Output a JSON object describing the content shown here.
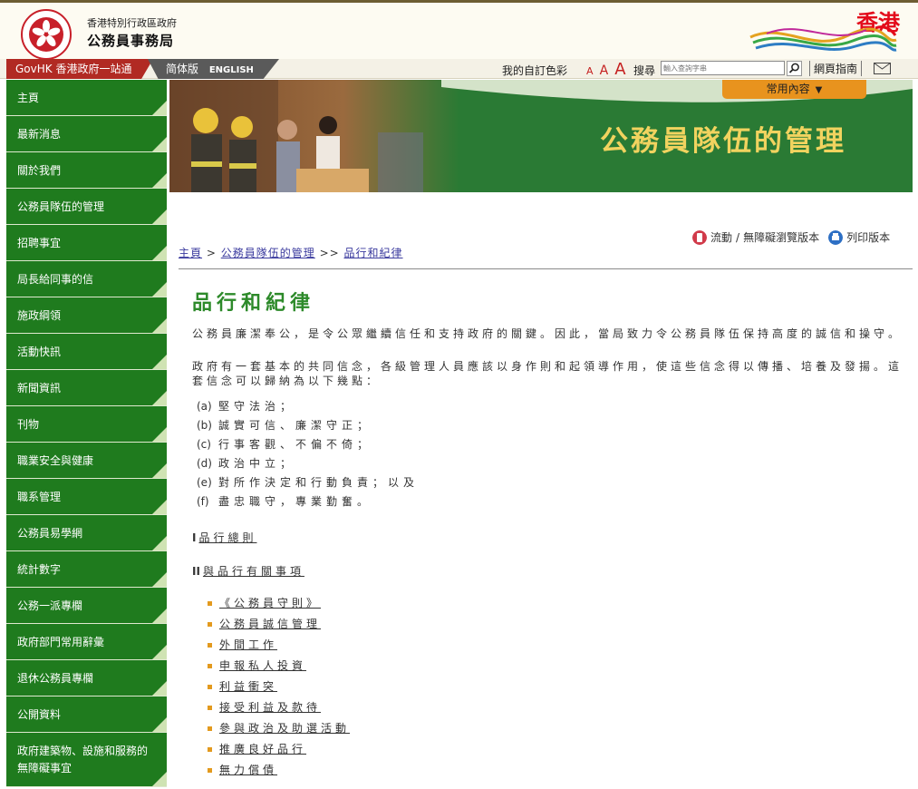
{
  "header": {
    "gov_name": "香港特別行政區政府",
    "bureau_name": "公務員事務局",
    "brand_text": "香港"
  },
  "topbar": {
    "govhk": "GovHK 香港政府一站通",
    "lang_simplified": "简体版",
    "lang_english": "ENGLISH",
    "colour_label": "我的自訂色彩",
    "font_small": "A",
    "font_medium": "A",
    "font_large": "A",
    "search_label": "搜尋",
    "search_placeholder": "輸入查詢字串",
    "site_guide": "網頁指南"
  },
  "sidebar": {
    "items": [
      {
        "label": "主頁"
      },
      {
        "label": "最新消息"
      },
      {
        "label": "關於我們"
      },
      {
        "label": "公務員隊伍的管理"
      },
      {
        "label": "招聘事宜"
      },
      {
        "label": "局長給同事的信"
      },
      {
        "label": "施政綱領"
      },
      {
        "label": "活動快訊"
      },
      {
        "label": "新聞資訊"
      },
      {
        "label": "刊物"
      },
      {
        "label": "職業安全與健康"
      },
      {
        "label": "職系管理"
      },
      {
        "label": "公務員易學網"
      },
      {
        "label": "統計數字"
      },
      {
        "label": "公務一派專欄"
      },
      {
        "label": "政府部門常用辭彙"
      },
      {
        "label": "退休公務員專欄"
      },
      {
        "label": "公開資料"
      },
      {
        "label": "政府建築物、設施和服務的無障礙事宜"
      }
    ]
  },
  "banner": {
    "title": "公務員隊伍的管理",
    "common_content": "常用內容",
    "common_arrow": "▼"
  },
  "tools": {
    "mobile": "流動",
    "sep": "/",
    "accessible": "無障礙瀏覽版本",
    "print": "列印版本"
  },
  "breadcrumb": {
    "home": "主頁",
    "sep1": ">",
    "section": "公務員隊伍的管理",
    "sep2": ">>",
    "current": "品行和紀律"
  },
  "main": {
    "title": "品行和紀律",
    "para1": "公務員廉潔奉公，是令公眾繼續信任和支持政府的關鍵。因此，當局致力令公務員隊伍保持高度的誠信和操守。",
    "para2": "政府有一套基本的共同信念，各級管理人員應該以身作則和起領導作用，使這些信念得以傳播、培養及發揚。這套信念可以歸納為以下幾點：",
    "items": [
      {
        "label": "(a)",
        "text": "堅守法治；"
      },
      {
        "label": "(b)",
        "text": "誠實可信、廉潔守正；"
      },
      {
        "label": "(c)",
        "text": "行事客觀、不偏不倚；"
      },
      {
        "label": "(d)",
        "text": "政治中立；"
      },
      {
        "label": "(e)",
        "text": "對所作決定和行動負責；以及"
      },
      {
        "label": "(f)",
        "text": "盡忠職守，專業勤奮。"
      }
    ],
    "sec1_num": "I",
    "sec1_label": "品行總則",
    "sec2_num": "II",
    "sec2_label": "與品行有關事項",
    "links": [
      {
        "label": "《公務員守則》"
      },
      {
        "label": "公務員誠信管理"
      },
      {
        "label": "外間工作"
      },
      {
        "label": "申報私人投資"
      },
      {
        "label": "利益衝突"
      },
      {
        "label": "接受利益及款待"
      },
      {
        "label": "參與政治及助選活動"
      },
      {
        "label": "推廣良好品行"
      },
      {
        "label": "無力償債"
      }
    ]
  },
  "colors": {
    "sidebar_green": "#1f7b1e",
    "title_green": "#2d8a2a",
    "banner_gold": "#f1d35f",
    "govhk_red": "#b12a23",
    "accent_orange": "#e8931e"
  }
}
